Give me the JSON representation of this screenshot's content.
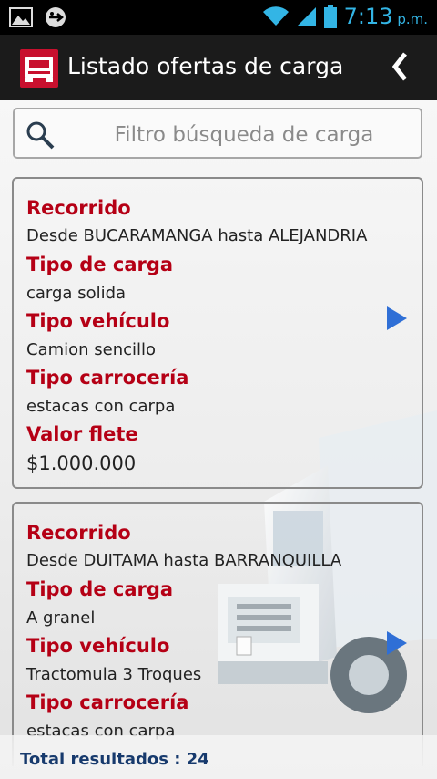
{
  "status_bar": {
    "time": "7:13",
    "ampm": "p.m.",
    "icons": [
      "image-icon",
      "usb-icon",
      "wifi-icon",
      "signal-icon",
      "battery-icon"
    ],
    "accent_color": "#33b5e5"
  },
  "app_bar": {
    "title": "Listado ofertas de carga",
    "back_icon": "chevron-left-icon",
    "logo_icon": "truck-icon",
    "logo_color": "#c8102e"
  },
  "search": {
    "placeholder": "Filtro búsqueda de carga",
    "value": "",
    "icon": "search-icon"
  },
  "offers": [
    {
      "recorrido_label": "Recorrido",
      "recorrido": "Desde BUCARAMANGA hasta ALEJANDRIA",
      "tipo_carga_label": "Tipo de carga",
      "tipo_carga": "carga solida",
      "tipo_vehiculo_label": "Tipo vehículo",
      "tipo_vehiculo": "Camion sencillo",
      "tipo_carroceria_label": "Tipo carrocería",
      "tipo_carroceria": "estacas con carpa",
      "valor_flete_label": "Valor flete",
      "valor_flete": "$1.000.000"
    },
    {
      "recorrido_label": "Recorrido",
      "recorrido": "Desde DUITAMA hasta BARRANQUILLA",
      "tipo_carga_label": "Tipo de carga",
      "tipo_carga": "A granel",
      "tipo_vehiculo_label": "Tipo vehículo",
      "tipo_vehiculo": "Tractomula 3 Troques",
      "tipo_carroceria_label": "Tipo carrocería",
      "tipo_carroceria": "estacas con carpa"
    }
  ],
  "footer": {
    "total_text": "Total resultados : 24"
  },
  "colors": {
    "label_red": "#b50015",
    "arrow_blue": "#2f6fd6",
    "footer_text": "#173a6d"
  }
}
